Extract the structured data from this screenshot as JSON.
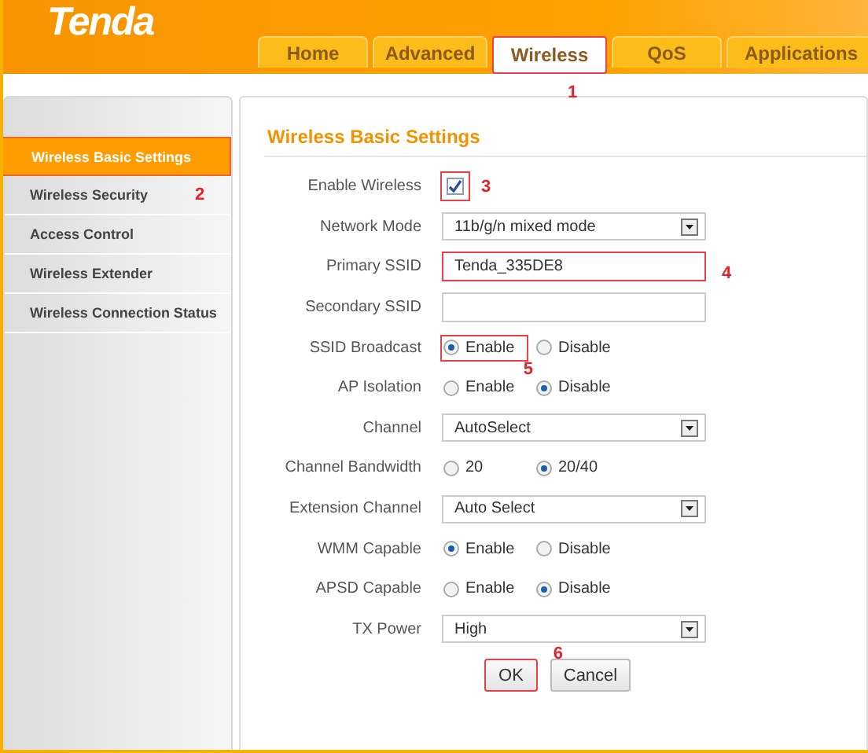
{
  "logo": "Tenda",
  "tabs": [
    {
      "label": "Home",
      "selected": false
    },
    {
      "label": "Advanced",
      "selected": false
    },
    {
      "label": "Wireless",
      "selected": true,
      "highlighted": true,
      "callout": "1"
    },
    {
      "label": "QoS",
      "selected": false
    },
    {
      "label": "Applications",
      "selected": false
    }
  ],
  "sidebar": {
    "items": [
      {
        "label": "Wireless Basic Settings",
        "selected": true
      },
      {
        "label": "Wireless Security",
        "selected": false,
        "callout": "2"
      },
      {
        "label": "Access Control",
        "selected": false
      },
      {
        "label": "Wireless Extender",
        "selected": false
      },
      {
        "label": "Wireless Connection Status",
        "selected": false
      }
    ]
  },
  "section_title": "Wireless Basic Settings",
  "rows": [
    {
      "kind": "checkbox",
      "label": "Enable Wireless",
      "checked": true,
      "highlighted": true,
      "callout": "3"
    },
    {
      "kind": "select",
      "label": "Network Mode",
      "value": "11b/g/n mixed mode"
    },
    {
      "kind": "text",
      "label": "Primary SSID",
      "value": "Tenda_335DE8",
      "highlighted": true,
      "callout": "4"
    },
    {
      "kind": "text",
      "label": "Secondary SSID",
      "value": "",
      "highlighted": false
    },
    {
      "kind": "radio",
      "label": "SSID Broadcast",
      "options": [
        {
          "label": "Enable",
          "selected": true,
          "highlighted": true,
          "callout": "5"
        },
        {
          "label": "Disable",
          "selected": false,
          "highlighted": false
        }
      ]
    },
    {
      "kind": "radio",
      "label": "AP Isolation",
      "options": [
        {
          "label": "Enable",
          "selected": false,
          "highlighted": false
        },
        {
          "label": "Disable",
          "selected": true,
          "highlighted": false
        }
      ]
    },
    {
      "kind": "select",
      "label": "Channel",
      "value": "AutoSelect"
    },
    {
      "kind": "radio",
      "label": "Channel Bandwidth",
      "options": [
        {
          "label": "20",
          "selected": false,
          "highlighted": false
        },
        {
          "label": "20/40",
          "selected": true,
          "highlighted": false
        }
      ]
    },
    {
      "kind": "select",
      "label": "Extension Channel",
      "value": "Auto Select"
    },
    {
      "kind": "radio",
      "label": "WMM Capable",
      "options": [
        {
          "label": "Enable",
          "selected": true,
          "highlighted": false
        },
        {
          "label": "Disable",
          "selected": false,
          "highlighted": false
        }
      ]
    },
    {
      "kind": "radio",
      "label": "APSD Capable",
      "options": [
        {
          "label": "Enable",
          "selected": false,
          "highlighted": false
        },
        {
          "label": "Disable",
          "selected": true,
          "highlighted": false
        }
      ]
    },
    {
      "kind": "select",
      "label": "TX Power",
      "value": "High"
    }
  ],
  "buttons": [
    {
      "label": "OK",
      "highlighted": true,
      "callout": "6"
    },
    {
      "label": "Cancel",
      "highlighted": false
    }
  ]
}
